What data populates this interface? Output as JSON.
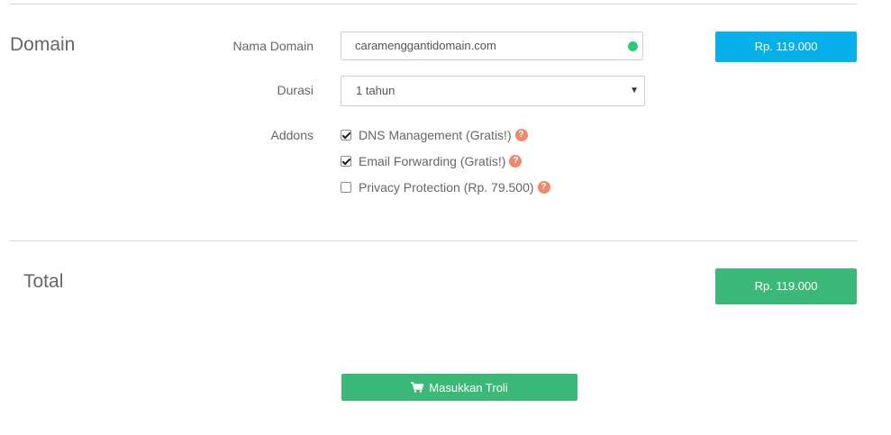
{
  "domain_section": {
    "title": "Domain",
    "name_label": "Nama Domain",
    "domain_value": "caramenggantidomain.com",
    "domain_status_color": "#2ecc71",
    "duration_label": "Durasi",
    "duration_selected": "1 tahun",
    "addons_label": "Addons",
    "addons": [
      {
        "label": "DNS Management (Gratis!)",
        "checked": true,
        "help_icon": "question-circle-icon"
      },
      {
        "label": "Email Forwarding (Gratis!)",
        "checked": true,
        "help_icon": "question-circle-icon"
      },
      {
        "label": "Privacy Protection (Rp. 79.500)",
        "checked": false,
        "help_icon": "question-circle-icon"
      }
    ],
    "price": "Rp. 119.000",
    "price_color": "#08b0ea"
  },
  "total_section": {
    "title": "Total",
    "price": "Rp. 119.000",
    "price_color": "#3cb878"
  },
  "cart_button": {
    "label": "Masukkan Troli",
    "icon": "shopping-cart-icon"
  }
}
